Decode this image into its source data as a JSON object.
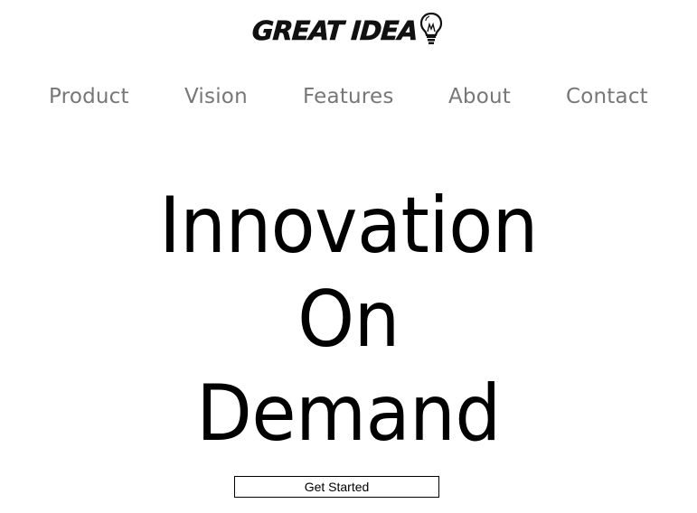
{
  "brand": {
    "logo_text": "GREAT IDEA",
    "logo_icon": "lightbulb-icon"
  },
  "nav": {
    "items": [
      {
        "label": "Product"
      },
      {
        "label": "Vision"
      },
      {
        "label": "Features"
      },
      {
        "label": "About"
      },
      {
        "label": "Contact"
      }
    ]
  },
  "hero": {
    "lines": [
      "Innovation",
      "On",
      "Demand"
    ]
  },
  "cta": {
    "label": "Get Started"
  },
  "colors": {
    "background": "#ffffff",
    "nav_text": "#777777",
    "hero_text": "#000000",
    "button_border": "#000000"
  }
}
